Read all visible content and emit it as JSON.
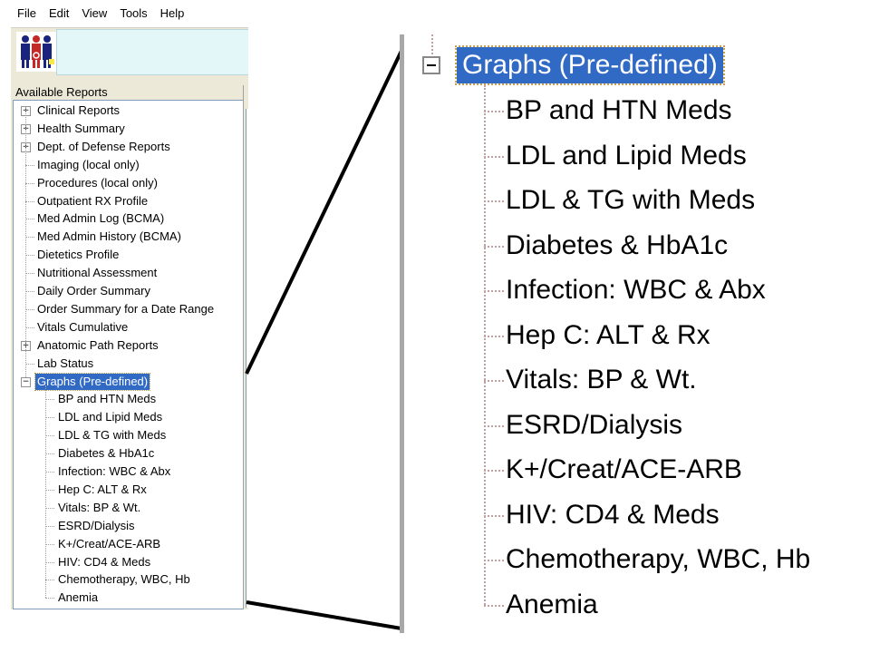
{
  "menu": [
    "File",
    "Edit",
    "View",
    "Tools",
    "Help"
  ],
  "reports_label": "Available Reports",
  "tree": [
    {
      "label": "Clinical Reports",
      "expander": "+"
    },
    {
      "label": "Health Summary",
      "expander": "+"
    },
    {
      "label": "Dept. of Defense Reports",
      "expander": "+"
    },
    {
      "label": "Imaging (local only)",
      "expander": ""
    },
    {
      "label": "Procedures (local only)",
      "expander": ""
    },
    {
      "label": "Outpatient RX Profile",
      "expander": ""
    },
    {
      "label": "Med Admin Log (BCMA)",
      "expander": ""
    },
    {
      "label": "Med Admin History (BCMA)",
      "expander": ""
    },
    {
      "label": "Dietetics Profile",
      "expander": ""
    },
    {
      "label": "Nutritional Assessment",
      "expander": ""
    },
    {
      "label": "Daily Order Summary",
      "expander": ""
    },
    {
      "label": "Order Summary for a Date Range",
      "expander": ""
    },
    {
      "label": "Vitals Cumulative",
      "expander": ""
    },
    {
      "label": "Anatomic Path Reports",
      "expander": "+"
    },
    {
      "label": "Lab Status",
      "expander": ""
    },
    {
      "label": "Graphs (Pre-defined)",
      "expander": "−",
      "selected": true
    }
  ],
  "graphs": [
    "BP and HTN Meds",
    "LDL and Lipid Meds",
    "LDL & TG with Meds",
    "Diabetes & HbA1c",
    "Infection: WBC & Abx",
    "Hep C: ALT & Rx",
    "Vitals: BP & Wt.",
    "ESRD/Dialysis",
    "K+/Creat/ACE-ARB",
    "HIV: CD4 & Meds",
    "Chemotherapy, WBC, Hb",
    "Anemia"
  ],
  "zoom_header": "Graphs (Pre-defined)",
  "colors": {
    "selection": "#316ac5",
    "window_bg": "#ece9d8",
    "patient_bar": "#e3f6f8"
  },
  "icons": {
    "logo": "people-logo-icon",
    "expand": "plus-box-icon",
    "collapse": "minus-box-icon"
  }
}
